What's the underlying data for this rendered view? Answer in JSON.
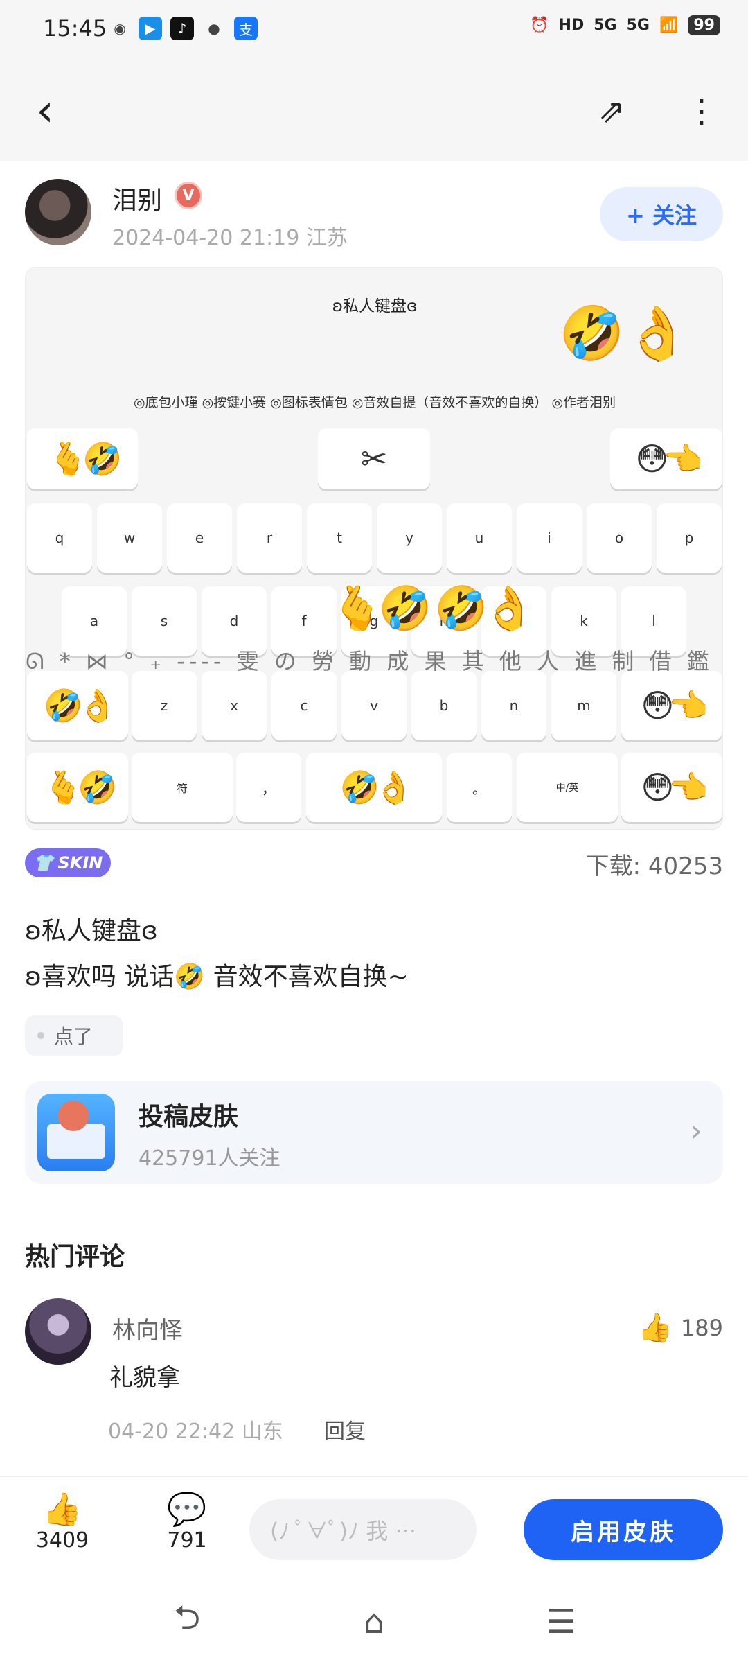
{
  "status_bar": {
    "time": "15:45",
    "app_icons": [
      {
        "name": "wechat-icon",
        "glyph": "◉",
        "color": "#444"
      },
      {
        "name": "bluedirect-icon",
        "glyph": "▶",
        "color": "#1a8fe8"
      },
      {
        "name": "tiktok-icon",
        "glyph": "♪",
        "color": "#111"
      },
      {
        "name": "message-icon",
        "glyph": "●",
        "color": "#444"
      },
      {
        "name": "alipay-icon",
        "glyph": "支",
        "color": "#1677ff"
      }
    ],
    "right": [
      "⏰",
      "HD",
      "5G",
      "5G",
      "📶"
    ],
    "battery": "99"
  },
  "toolbar": {
    "back_icon": "‹",
    "share_icon": "⇗",
    "more_icon": "⋮"
  },
  "author": {
    "name": "泪别",
    "verified": "V",
    "date_location": "2024-04-20 21:19 江苏",
    "follow_label": "+ 关注"
  },
  "preview": {
    "title": "ʚ私人键盘ɞ",
    "description": "◎底包小瑾 ◎按键小赛 ◎图标表情包 ◎音效自提（音效不喜欢的自换） ◎作者泪别",
    "top_emoji": "🤣👌",
    "watermark": "ᘏ * ⋈ ° ₊ ---- 雯 の 勞 動 成 果  其 他 人 進 制 借 鑑 ---- ° ⋈ * ᘐ",
    "func_row": {
      "left": "🫰🤣",
      "center": "✂",
      "right": "😳👈"
    },
    "row1": [
      "q",
      "w",
      "e",
      "r",
      "t",
      "y",
      "u",
      "i",
      "o",
      "p"
    ],
    "row2": [
      "a",
      "s",
      "d",
      "f",
      "g",
      "h",
      "j",
      "k",
      "l"
    ],
    "row2_overlay": "🫰🤣  🤣👌",
    "row3_left": "🤣👌",
    "row3": [
      "z",
      "x",
      "c",
      "v",
      "b",
      "n",
      "m"
    ],
    "row3_right": "😳👈",
    "row4": {
      "left": "🫰🤣",
      "sym": "符",
      "comma": "，",
      "space": "🤣👌",
      "period": "。",
      "lang": "中/英",
      "right": "😳👈"
    }
  },
  "meta": {
    "skin_label": "SKIN",
    "downloads": "下载: 40253"
  },
  "post": {
    "title": "ʚ私人键盘ɞ",
    "description": "ʚ喜欢吗 说话🤣 音效不喜欢自换~",
    "tag": "点了"
  },
  "topic": {
    "name": "投稿皮肤",
    "followers": "425791人关注",
    "chevron": "›"
  },
  "comments": {
    "heading": "热门评论",
    "items": [
      {
        "name": "林向怿",
        "text": "礼貌拿",
        "meta": "04-20 22:42 山东",
        "reply": "回复",
        "likes": "189"
      }
    ]
  },
  "bottom_bar": {
    "like_icon": "👍",
    "like_count": "3409",
    "comment_icon": "💬",
    "comment_count": "791",
    "comment_placeholder": "(ﾉ ﾟ∀ﾟ)ﾉ 我 ···",
    "enable_label": "启用皮肤"
  },
  "nav_bar": {
    "back": "⮌",
    "home": "⌂",
    "menu": "☰"
  }
}
